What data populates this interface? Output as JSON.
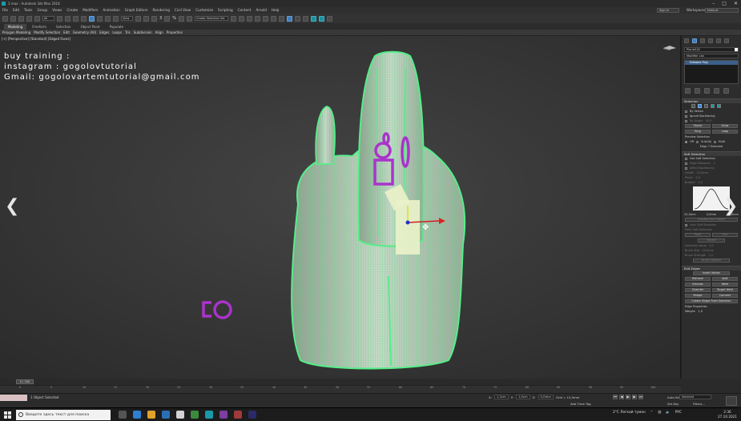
{
  "window": {
    "title": "3 max - Autodesk 3ds Max 2018"
  },
  "menu": [
    "File",
    "Edit",
    "Tools",
    "Group",
    "Views",
    "Create",
    "Modifiers",
    "Animation",
    "Graph Editors",
    "Rendering",
    "Civil View",
    "Customize",
    "Scripting",
    "Content",
    "Arnold",
    "Help"
  ],
  "account": {
    "signin": "Sign In",
    "workspaces_label": "Workspaces:",
    "workspace": "Default"
  },
  "toolbar": {
    "filter": "All",
    "ref_coord": "View",
    "selection_set": "Create Selection Set",
    "snap_label": "3",
    "angle_label": "%"
  },
  "ribbon": {
    "tabs": [
      "Modeling",
      "Freeform",
      "Selection",
      "Object Paint",
      "Populate"
    ],
    "active_tab": "Modeling",
    "items": [
      "Polygon Modeling",
      "Modify Selection",
      "Edit",
      "Geometry (All)",
      "Edges",
      "Loops",
      "Tris",
      "Subdivision",
      "Align",
      "Properties"
    ]
  },
  "viewport": {
    "label": "[+] [Perspective] [Standard] [Edged Faces]",
    "watermark": [
      "buy training :",
      "instagram : gogolovtutorial",
      "Gmail: gogolovartemtutorial@gmail.com"
    ],
    "wire_color": "#44dd77",
    "mesh_color": "#c8d8c8",
    "accent_color": "#aa33cc"
  },
  "command_panel": {
    "object_name": "Plane018",
    "modifier_list": "Modifier List",
    "stack_item": "Editable Poly",
    "selection": {
      "title": "Selection",
      "by_vertex": "By Vertex",
      "ignore_backfacing": "Ignore Backfacing",
      "by_angle": "By Angle:",
      "by_angle_value": "45,0",
      "shrink": "Shrink",
      "grow": "Grow",
      "ring": "Ring",
      "loop": "Loop",
      "preview": "Preview Selection",
      "off": "Off",
      "subobj": "SubObj",
      "multi": "Multi",
      "status": "Edge 7 Selected"
    },
    "soft": {
      "title": "Soft Selection",
      "use": "Use Soft Selection",
      "edge_distance": "Edge Distance:",
      "edge_distance_value": "1",
      "affect_backfacing": "Affect Backfacing",
      "falloff": "Falloff:",
      "falloff_value": "20,0mm",
      "pinch": "Pinch:",
      "pinch_value": "0,0",
      "bubble": "Bubble:",
      "bubble_value": "0,0",
      "curve_labels": [
        "20,0mm",
        "0,0mm",
        "20,0mm"
      ],
      "shaded_face": "Shaded Face Toggle",
      "lock_soft": "Lock Soft Selection",
      "paint_soft": "Paint Soft Selection",
      "paint": "Paint",
      "blur": "Blur",
      "revert": "Revert",
      "sel_value": "Selection Value",
      "sel_value_value": "1,0",
      "brush_size": "Brush Size",
      "brush_size_value": "20,0mm",
      "brush_strength": "Brush Strength",
      "brush_strength_value": "1,0",
      "brush_options": "Brush Options"
    },
    "edit_edges": {
      "title": "Edit Edges",
      "insert_vertex": "Insert Vertex",
      "remove": "Remove",
      "split": "Split",
      "extrude": "Extrude",
      "weld": "Weld",
      "chamfer": "Chamfer",
      "target_weld": "Target Weld",
      "bridge": "Bridge",
      "connect": "Connect",
      "create_shape": "Create Shape From Selection",
      "edge_props": "Edge Properties",
      "weight": "Weight:",
      "weight_value": "1,0"
    }
  },
  "timeline": {
    "frame": "0 / 100",
    "ticks": [
      "0",
      "5",
      "10",
      "15",
      "20",
      "25",
      "30",
      "35",
      "40",
      "45",
      "50",
      "55",
      "60",
      "65",
      "70",
      "75",
      "80",
      "85",
      "90",
      "95",
      "100"
    ]
  },
  "status": {
    "objects": "1 Object Selected",
    "x_label": "X:",
    "x_value": "1,2cm",
    "y_label": "Y:",
    "y_value": "1,0cm",
    "z_label": "Z:",
    "z_value": "0,0mm",
    "grid": "Grid = 10,0mm",
    "add_time_tag": "Add Time Tag",
    "auto_key": "Auto Key",
    "set_key": "Set Key",
    "selected": "Selected",
    "filters": "Filters..."
  },
  "taskbar": {
    "search": "Введите здесь текст для поиска",
    "weather": "2°C Легкий туман",
    "lang": "РУС",
    "time": "2:36",
    "date": "27.10.2021"
  }
}
